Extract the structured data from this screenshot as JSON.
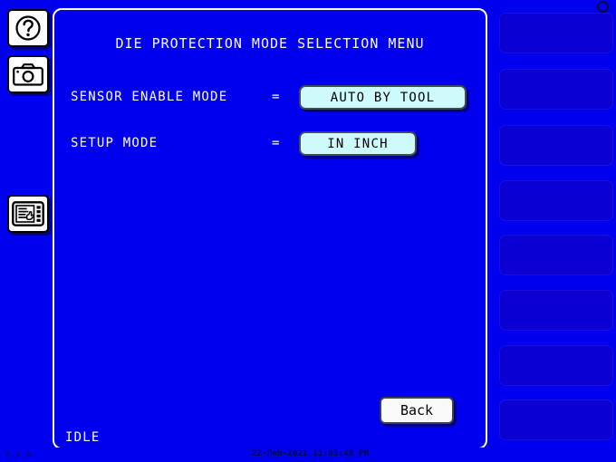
{
  "colors": {
    "background": "#0000ee",
    "panel_border": "#ffffff",
    "value_button_fill": "#cdfbfb",
    "back_button_fill": "#fafafa",
    "function_button_fill": "#0b00d2",
    "text_primary": "#ffffff",
    "text_on_button": "#000000"
  },
  "left_rail": {
    "buttons": [
      {
        "name": "help-icon",
        "label": "?"
      },
      {
        "name": "camera-icon",
        "label": "camera"
      },
      {
        "name": "touchscreen-menu-icon",
        "label": "menu"
      }
    ]
  },
  "main": {
    "title": "DIE PROTECTION MODE SELECTION MENU",
    "rows": [
      {
        "label": "SENSOR ENABLE MODE",
        "equals": "=",
        "value": "AUTO BY TOOL"
      },
      {
        "label": "SETUP MODE",
        "equals": "=",
        "value": "IN INCH"
      }
    ],
    "back_label": "Back",
    "status": "IDLE"
  },
  "right_rail": {
    "buttons": [
      {
        "label": ""
      },
      {
        "label": ""
      },
      {
        "label": ""
      },
      {
        "label": ""
      },
      {
        "label": ""
      },
      {
        "label": ""
      },
      {
        "label": ""
      },
      {
        "label": ""
      }
    ]
  },
  "footer": {
    "version": "4.8.0",
    "datetime": "22-Feb-2021 11:03:48 PM"
  }
}
